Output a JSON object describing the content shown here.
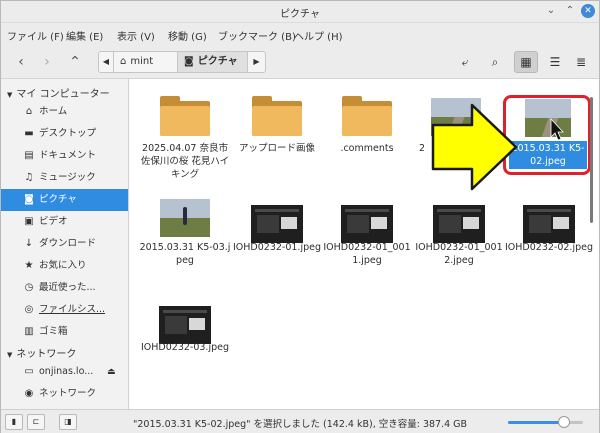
{
  "window": {
    "title": "ピクチャ"
  },
  "menubar": {
    "items": [
      "ファイル (F)",
      "編集 (E)",
      "表示 (V)",
      "移動 (G)",
      "ブックマーク (B)",
      "ヘルプ (H)"
    ]
  },
  "toolbar": {
    "breadcrumb": [
      "mint",
      "ピクチャ"
    ],
    "breadcrumb_icons": [
      "home-icon",
      "camera-icon"
    ]
  },
  "sidebar": {
    "my_computer": "マイ コンピューター",
    "items": [
      {
        "label": "ホーム",
        "icon": "home-icon"
      },
      {
        "label": "デスクトップ",
        "icon": "desktop-icon"
      },
      {
        "label": "ドキュメント",
        "icon": "document-icon"
      },
      {
        "label": "ミュージック",
        "icon": "music-icon"
      },
      {
        "label": "ピクチャ",
        "icon": "camera-icon",
        "selected": true
      },
      {
        "label": "ビデオ",
        "icon": "video-icon"
      },
      {
        "label": "ダウンロード",
        "icon": "download-icon"
      },
      {
        "label": "お気に入り",
        "icon": "star-icon"
      },
      {
        "label": "最近使った...",
        "icon": "clock-icon"
      },
      {
        "label": "ファイルシス...",
        "icon": "drive-icon"
      },
      {
        "label": "ゴミ箱",
        "icon": "trash-icon"
      }
    ],
    "network": "ネットワーク",
    "network_items": [
      {
        "label": "onjinas.lo...",
        "icon": "network-drive-icon"
      },
      {
        "label": "ネットワーク",
        "icon": "network-icon"
      }
    ]
  },
  "files": [
    {
      "name": "2025.04.07 奈良市 佐保川の桜 花見ハイキング",
      "type": "folder"
    },
    {
      "name": "アップロード画像",
      "type": "folder"
    },
    {
      "name": ".comments",
      "type": "folder"
    },
    {
      "name": "2",
      "type": "photo"
    },
    {
      "name": "2015.03.31 K5-02.jpeg",
      "type": "photo",
      "selected": true
    },
    {
      "name": "2015.03.31 K5-03.jpeg",
      "type": "photo"
    },
    {
      "name": "IOHD0232-01.jpeg",
      "type": "screenshot"
    },
    {
      "name": "IOHD0232-01_0011.jpeg",
      "type": "screenshot"
    },
    {
      "name": "IOHD0232-01_0012.jpeg",
      "type": "screenshot"
    },
    {
      "name": "IOHD0232-02.jpeg",
      "type": "screenshot"
    },
    {
      "name": "IOHD0232-03.jpeg",
      "type": "screenshot"
    }
  ],
  "statusbar": {
    "text": "\"2015.03.31 K5-02.jpeg\" を選択しました (142.4 kB), 空き容量: 387.4 GB",
    "zoom_level": 0.72
  },
  "colors": {
    "selection": "#2f8ce0",
    "highlight_frame": "#e0202a",
    "arrow_fill": "#ffff00"
  }
}
